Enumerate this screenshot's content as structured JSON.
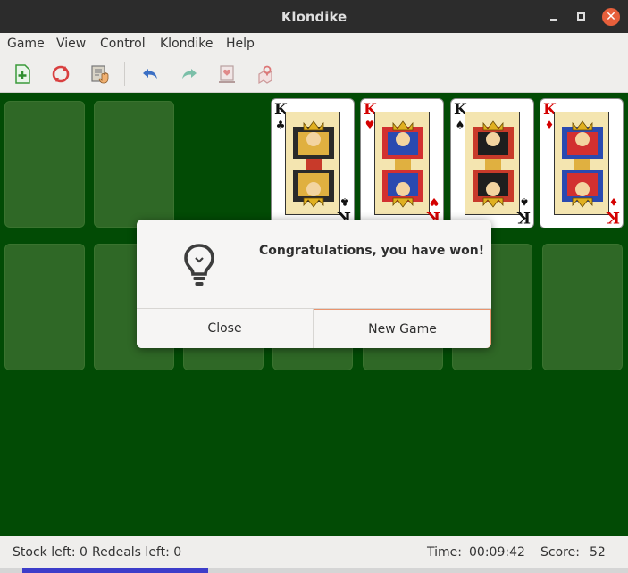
{
  "window": {
    "title": "Klondike"
  },
  "menu": [
    "Game",
    "View",
    "Control",
    "Klondike",
    "Help"
  ],
  "toolbar": {
    "icons": [
      "new-game-icon",
      "restart-icon",
      "deal-icon",
      "undo-icon",
      "redo-icon",
      "hint-icon",
      "fullscreen-icon"
    ]
  },
  "foundations": [
    {
      "rank": "K",
      "suit": "♣",
      "color": "black"
    },
    {
      "rank": "K",
      "suit": "♥",
      "color": "red"
    },
    {
      "rank": "K",
      "suit": "♠",
      "color": "black"
    },
    {
      "rank": "K",
      "suit": "♦",
      "color": "red"
    }
  ],
  "dialog": {
    "message": "Congratulations, you have won!",
    "close_label": "Close",
    "new_game_label": "New Game"
  },
  "status": {
    "stock": "Stock left: 0",
    "redeals": "Redeals left: 0",
    "time_label": "Time:",
    "time_value": "00:09:42",
    "score_label": "Score:",
    "score_value": "52"
  },
  "colors": {
    "felt": "#024b05",
    "slot": "#2f6826",
    "accent": "#e9946e"
  }
}
